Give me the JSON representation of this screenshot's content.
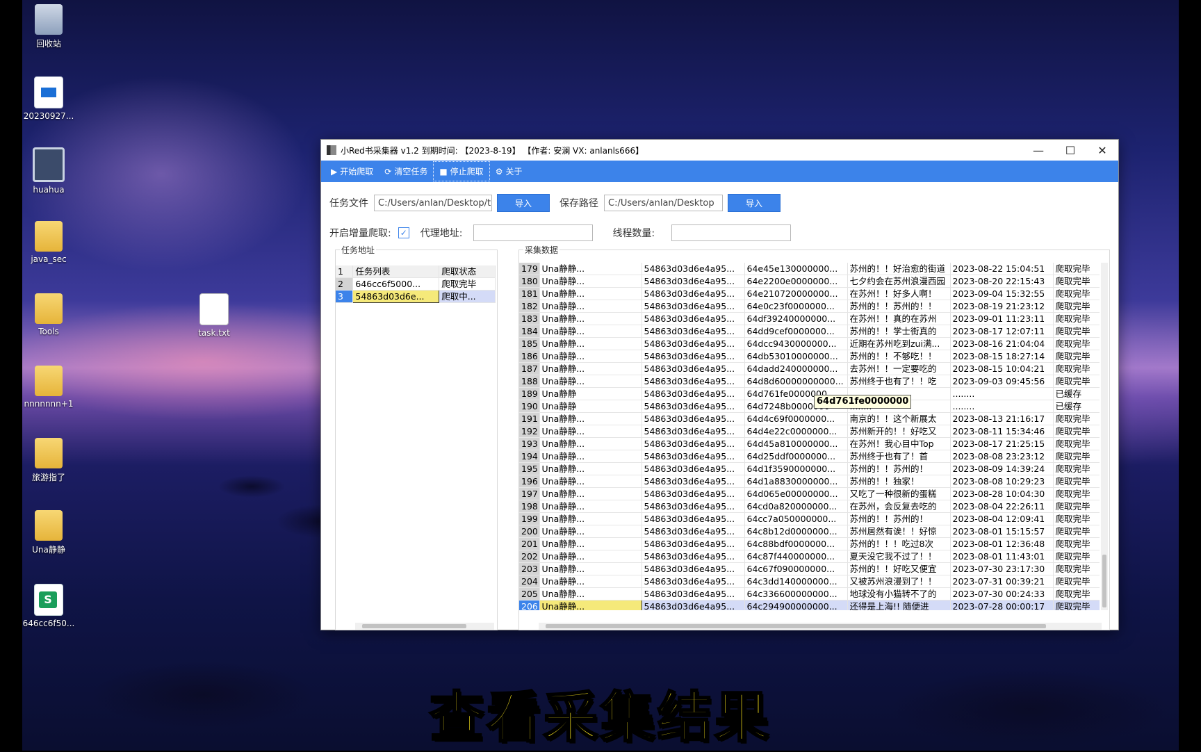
{
  "desktop": {
    "icons": [
      {
        "label": "回收站",
        "icon": "recycle-bin-icon"
      },
      {
        "label": "20230927...",
        "icon": "video-file-icon"
      },
      {
        "label": "huahua",
        "icon": "monitor-icon"
      },
      {
        "label": "java_sec",
        "icon": "folder-icon"
      },
      {
        "label": "Tools",
        "icon": "folder-icon"
      },
      {
        "label": "task.txt",
        "icon": "text-file-icon"
      },
      {
        "label": "nnnnnnn+1",
        "icon": "folder-icon"
      },
      {
        "label": "旅游指了",
        "icon": "folder-icon"
      },
      {
        "label": "Una静静",
        "icon": "folder-icon"
      },
      {
        "label": "646cc6f50...",
        "icon": "spreadsheet-icon"
      }
    ]
  },
  "window": {
    "title": "小Red书采集器 v1.2 到期时间: 【2023-8-19】 【作者: 安澜 VX: anlanls666】",
    "controls": {
      "minimize": "—",
      "maximize": "☐",
      "close": "✕"
    }
  },
  "toolbar": {
    "start": "开始爬取",
    "clear": "清空任务",
    "stop": "停止爬取",
    "about": "关于"
  },
  "form": {
    "task_file_label": "任务文件",
    "task_file_value": "C:/Users/anlan/Desktop/t",
    "import1": "导入",
    "save_path_label": "保存路径",
    "save_path_value": "C:/Users/anlan/Desktop",
    "import2": "导入",
    "incremental_label": "开启增量爬取:",
    "incremental_checked": "✓",
    "proxy_label": "代理地址:",
    "proxy_value": "",
    "threads_label": "线程数量:",
    "threads_value": ""
  },
  "task_panel": {
    "group_label": "任务地址",
    "rows": [
      {
        "num": "1",
        "task": "任务列表",
        "status": "爬取状态"
      },
      {
        "num": "2",
        "task": "646cc6f5000...",
        "status": "爬取完毕"
      },
      {
        "num": "3",
        "task": "54863d03d6e...",
        "status": "爬取中..."
      }
    ]
  },
  "data_panel": {
    "group_label": "采集数据",
    "tooltip": "64d761fe0000000",
    "rows": [
      {
        "num": "179",
        "user": "Una静静...",
        "uid": "54863d03d6e4a95...",
        "nid": "64e45e130000000...",
        "title": "苏州的！！好治愈的街道",
        "time": "2023-08-22 15:04:51",
        "status": "爬取完毕"
      },
      {
        "num": "180",
        "user": "Una静静...",
        "uid": "54863d03d6e4a95...",
        "nid": "64e2200e0000000...",
        "title": "七夕约会在苏州浪漫西园",
        "time": "2023-08-20 22:15:43",
        "status": "爬取完毕"
      },
      {
        "num": "181",
        "user": "Una静静...",
        "uid": "54863d03d6e4a95...",
        "nid": "64e210720000000...",
        "title": "在苏州！！好多人啊！",
        "time": "2023-09-04 15:32:55",
        "status": "爬取完毕"
      },
      {
        "num": "182",
        "user": "Una静静...",
        "uid": "54863d03d6e4a95...",
        "nid": "64e0c23f0000000...",
        "title": "苏州的！！苏州的！！",
        "time": "2023-08-19 21:23:12",
        "status": "爬取完毕"
      },
      {
        "num": "183",
        "user": "Una静静...",
        "uid": "54863d03d6e4a95...",
        "nid": "64df39240000000...",
        "title": "在苏州！！真的在苏州",
        "time": "2023-09-01 11:23:11",
        "status": "爬取完毕"
      },
      {
        "num": "184",
        "user": "Una静静...",
        "uid": "54863d03d6e4a95...",
        "nid": "64dd9cef0000000...",
        "title": "苏州的！！学士街真的",
        "time": "2023-08-17 12:07:11",
        "status": "爬取完毕"
      },
      {
        "num": "185",
        "user": "Una静静...",
        "uid": "54863d03d6e4a95...",
        "nid": "64dcc9430000000...",
        "title": "近期在苏州吃到zui满...",
        "time": "2023-08-16 21:04:04",
        "status": "爬取完毕"
      },
      {
        "num": "186",
        "user": "Una静静...",
        "uid": "54863d03d6e4a95...",
        "nid": "64db53010000000...",
        "title": "苏州的！！不够吃！！",
        "time": "2023-08-15 18:27:14",
        "status": "爬取完毕"
      },
      {
        "num": "187",
        "user": "Una静静...",
        "uid": "54863d03d6e4a95...",
        "nid": "64dadd240000000...",
        "title": "去苏州！！一定要吃的",
        "time": "2023-08-15 10:04:21",
        "status": "爬取完毕"
      },
      {
        "num": "188",
        "user": "Una静静...",
        "uid": "54863d03d6e4a95...",
        "nid": "64d8d60000000000...",
        "title": "苏州终于也有了！！吃",
        "time": "2023-09-03 09:45:56",
        "status": "爬取完毕"
      },
      {
        "num": "189",
        "user": "Una静静",
        "uid": "54863d03d6e4a95...",
        "nid": "64d761fe0000000",
        "title": "",
        "time": "........",
        "status": "已缓存"
      },
      {
        "num": "190",
        "user": "Una静静",
        "uid": "54863d03d6e4a95...",
        "nid": "64d7248b0000000",
        "title": "........",
        "time": "........",
        "status": "已缓存"
      },
      {
        "num": "191",
        "user": "Una静静...",
        "uid": "54863d03d6e4a95...",
        "nid": "64d4c69f0000000...",
        "title": "南京的！！这个新展太",
        "time": "2023-08-13 21:16:17",
        "status": "爬取完毕"
      },
      {
        "num": "192",
        "user": "Una静静...",
        "uid": "54863d03d6e4a95...",
        "nid": "64d4e22c0000000...",
        "title": "苏州新开的！！好吃又",
        "time": "2023-08-11 15:34:46",
        "status": "爬取完毕"
      },
      {
        "num": "193",
        "user": "Una静静...",
        "uid": "54863d03d6e4a95...",
        "nid": "64d45a810000000...",
        "title": "在苏州！我心目中Top",
        "time": "2023-08-17 21:25:15",
        "status": "爬取完毕"
      },
      {
        "num": "194",
        "user": "Una静静...",
        "uid": "54863d03d6e4a95...",
        "nid": "64d25ddf0000000...",
        "title": "苏州终于也有了！首",
        "time": "2023-08-08 23:23:12",
        "status": "爬取完毕"
      },
      {
        "num": "195",
        "user": "Una静静...",
        "uid": "54863d03d6e4a95...",
        "nid": "64d1f3590000000...",
        "title": "苏州的！！苏州的！",
        "time": "2023-08-09 14:39:24",
        "status": "爬取完毕"
      },
      {
        "num": "196",
        "user": "Una静静...",
        "uid": "54863d03d6e4a95...",
        "nid": "64d1a8830000000...",
        "title": "苏州的！！独家！",
        "time": "2023-08-08 10:29:23",
        "status": "爬取完毕"
      },
      {
        "num": "197",
        "user": "Una静静...",
        "uid": "54863d03d6e4a95...",
        "nid": "64d065e00000000...",
        "title": "又吃了一种很新的蛋糕",
        "time": "2023-08-28 10:04:30",
        "status": "爬取完毕"
      },
      {
        "num": "198",
        "user": "Una静静...",
        "uid": "54863d03d6e4a95...",
        "nid": "64cd0a820000000...",
        "title": "在苏州，会反复去吃的",
        "time": "2023-08-04 22:26:11",
        "status": "爬取完毕"
      },
      {
        "num": "199",
        "user": "Una静静...",
        "uid": "54863d03d6e4a95...",
        "nid": "64cc7a050000000...",
        "title": "苏州的！！苏州的！",
        "time": "2023-08-04 12:09:41",
        "status": "爬取完毕"
      },
      {
        "num": "200",
        "user": "Una静静...",
        "uid": "54863d03d6e4a95...",
        "nid": "64c8b12d0000000...",
        "title": "苏州居然有诶！！好惊",
        "time": "2023-08-01 15:15:57",
        "status": "爬取完毕"
      },
      {
        "num": "201",
        "user": "Una静静...",
        "uid": "54863d03d6e4a95...",
        "nid": "64c88bdf0000000...",
        "title": "苏州的！！！吃过8次",
        "time": "2023-08-01 12:36:48",
        "status": "爬取完毕"
      },
      {
        "num": "202",
        "user": "Una静静...",
        "uid": "54863d03d6e4a95...",
        "nid": "64c87f440000000...",
        "title": "夏天没它我不过了！！",
        "time": "2023-08-01 11:43:01",
        "status": "爬取完毕"
      },
      {
        "num": "203",
        "user": "Una静静...",
        "uid": "54863d03d6e4a95...",
        "nid": "64c67f090000000...",
        "title": "苏州的！！好吃又便宜",
        "time": "2023-07-30 23:17:30",
        "status": "爬取完毕"
      },
      {
        "num": "204",
        "user": "Una静静...",
        "uid": "54863d03d6e4a95...",
        "nid": "64c3dd140000000...",
        "title": "又被苏州浪漫到了！！",
        "time": "2023-07-31 00:39:21",
        "status": "爬取完毕"
      },
      {
        "num": "205",
        "user": "Una静静...",
        "uid": "54863d03d6e4a95...",
        "nid": "64c336600000000...",
        "title": "地球没有小猫转不了的",
        "time": "2023-07-30 00:24:33",
        "status": "爬取完毕"
      },
      {
        "num": "206",
        "user": "Una静静...",
        "uid": "54863d03d6e4a95...",
        "nid": "64c294900000000...",
        "title": "还得是上海!! 随便进",
        "time": "2023-07-28 00:00:17",
        "status": "爬取完毕"
      }
    ]
  },
  "caption": "查看采集结果"
}
